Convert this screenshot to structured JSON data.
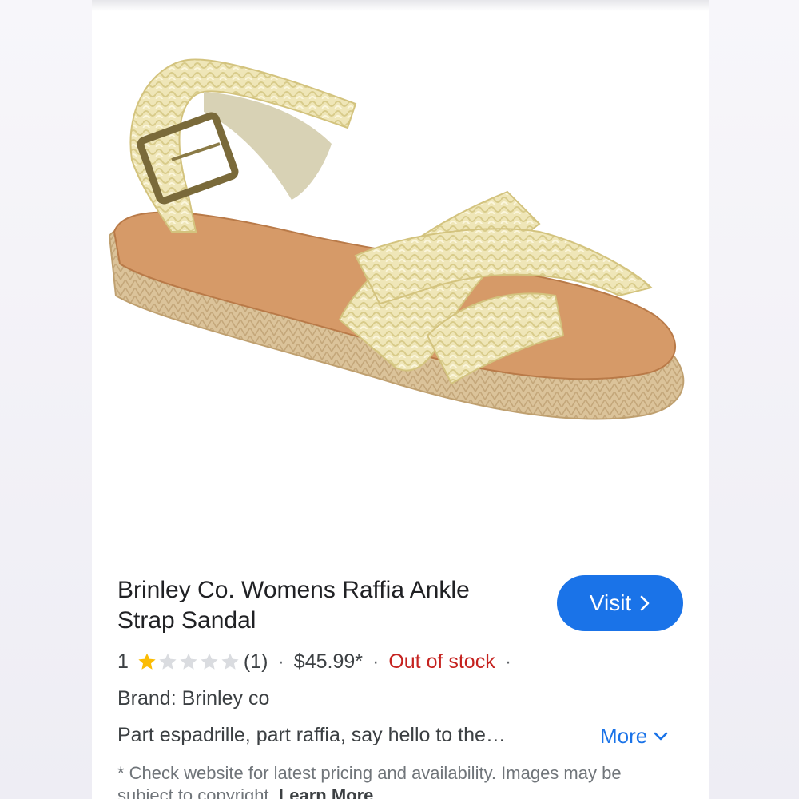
{
  "product": {
    "title": "Brinley Co. Womens Raffia Ankle Strap Sandal",
    "visit_label": "Visit",
    "rating_value": "1",
    "rating_stars": 1,
    "rating_max": 5,
    "review_count": "(1)",
    "price": "$45.99*",
    "separator": "·",
    "stock_status": "Out of stock",
    "brand": "Brand: Brinley co",
    "description": "Part espadrille, part raffia, say hello to the…",
    "more_label": "More",
    "disclaimer": "* Check website for latest pricing and availability. Images may be subject to copyright.",
    "learn_more_label": "Learn More"
  },
  "icons": {
    "visit": "chevron-right-icon",
    "more": "chevron-down-icon",
    "star_filled": "star-filled-icon",
    "star_empty": "star-empty-icon"
  },
  "colors": {
    "accent": "#1a73e8",
    "out_of_stock": "#c5221f",
    "star_filled": "#fbbc04",
    "star_empty": "#dadce0"
  }
}
